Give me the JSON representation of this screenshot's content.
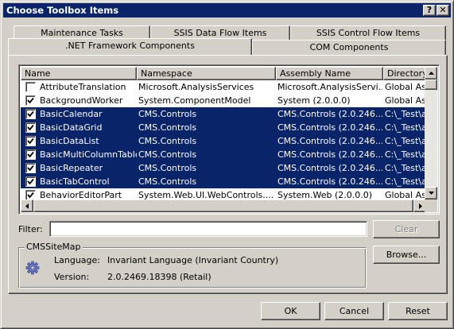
{
  "window": {
    "title": "Choose Toolbox Items",
    "help_label": "?",
    "close_label": "✕"
  },
  "tabs": [
    {
      "label": "Maintenance Tasks"
    },
    {
      "label": "SSIS Data Flow Items"
    },
    {
      "label": "SSIS Control Flow Items"
    },
    {
      "label": ".NET Framework Components",
      "active": true
    },
    {
      "label": "COM Components"
    }
  ],
  "list": {
    "columns": [
      "Name",
      "Namespace",
      "Assembly Name",
      "Directory"
    ],
    "rows": [
      {
        "checked": false,
        "selected": false,
        "name": "AttributeTranslation",
        "namespace": "Microsoft.AnalysisServices",
        "assembly": "Microsoft.AnalysisServi...",
        "directory": "Global Ass"
      },
      {
        "checked": true,
        "selected": false,
        "name": "BackgroundWorker",
        "namespace": "System.ComponentModel",
        "assembly": "System (2.0.0.0)",
        "directory": "Global Ass"
      },
      {
        "checked": true,
        "selected": true,
        "name": "BasicCalendar",
        "namespace": "CMS.Controls",
        "assembly": "CMS.Controls (2.0.246...",
        "directory": "C:\\_Test\\a"
      },
      {
        "checked": true,
        "selected": true,
        "name": "BasicDataGrid",
        "namespace": "CMS.Controls",
        "assembly": "CMS.Controls (2.0.246...",
        "directory": "C:\\_Test\\a"
      },
      {
        "checked": true,
        "selected": true,
        "name": "BasicDataList",
        "namespace": "CMS.Controls",
        "assembly": "CMS.Controls (2.0.246...",
        "directory": "C:\\_Test\\a"
      },
      {
        "checked": true,
        "selected": true,
        "name": "BasicMultiColumnTable",
        "namespace": "CMS.Controls",
        "assembly": "CMS.Controls (2.0.246...",
        "directory": "C:\\_Test\\a"
      },
      {
        "checked": true,
        "selected": true,
        "name": "BasicRepeater",
        "namespace": "CMS.Controls",
        "assembly": "CMS.Controls (2.0.246...",
        "directory": "C:\\_Test\\a"
      },
      {
        "checked": true,
        "selected": true,
        "name": "BasicTabControl",
        "namespace": "CMS.Controls",
        "assembly": "CMS.Controls (2.0.246...",
        "directory": "C:\\_Test\\a"
      },
      {
        "checked": true,
        "selected": false,
        "name": "BehaviorEditorPart",
        "namespace": "System.Web.UI.WebControls....",
        "assembly": "System.Web (2.0.0.0)",
        "directory": "Global Ass"
      }
    ]
  },
  "filter": {
    "label": "Filter:",
    "value": "",
    "clear_label": "Clear"
  },
  "details": {
    "group_title": "CMSSiteMap",
    "language_label": "Language:",
    "language_value": "Invariant Language (Invariant Country)",
    "version_label": "Version:",
    "version_value": "2.0.2469.18398 (Retail)",
    "icon": "gear-icon",
    "browse_label": "Browse..."
  },
  "footer": {
    "ok_label": "OK",
    "cancel_label": "Cancel",
    "reset_label": "Reset"
  },
  "colors": {
    "title_bar": "#0a246a",
    "selection": "#0a246a",
    "face": "#d4d0c8"
  }
}
